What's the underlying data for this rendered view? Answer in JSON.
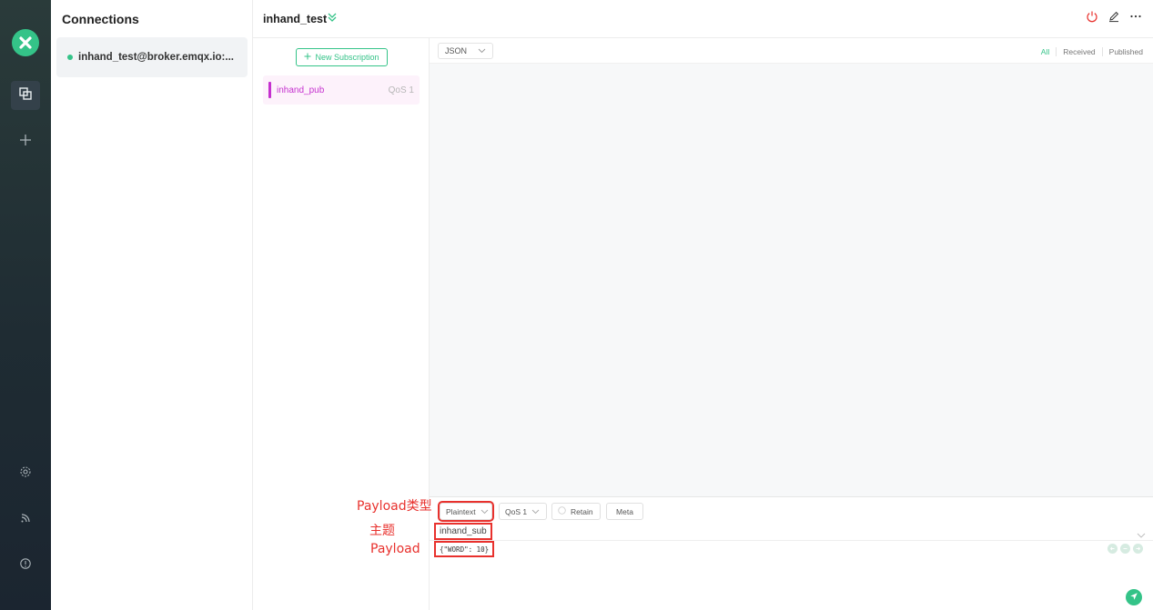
{
  "sidebar": {
    "nav_icons": [
      "connections-icon",
      "plus-icon",
      "settings-icon",
      "feed-icon",
      "info-icon"
    ]
  },
  "connections": {
    "title": "Connections",
    "items": [
      {
        "label": "inhand_test@broker.emqx.io:...",
        "status": "connected"
      }
    ]
  },
  "header": {
    "title": "inhand_test"
  },
  "subscriptions": {
    "new_button": "New Subscription",
    "items": [
      {
        "topic": "inhand_pub",
        "qos": "QoS 1",
        "color": "#c531cf"
      }
    ]
  },
  "messages": {
    "format": "JSON",
    "filters": [
      "All",
      "Received",
      "Published"
    ]
  },
  "publish": {
    "payload_type": "Plaintext",
    "qos": "QoS 1",
    "retain_label": "Retain",
    "meta_label": "Meta",
    "topic": "inhand_sub",
    "payload": "{\"WORD\": 10}"
  },
  "annotations": {
    "payload_type": "Payload类型",
    "topic": "主题",
    "payload": "Payload"
  },
  "colors": {
    "accent": "#34c388",
    "annotation": "#e8312d",
    "disconnect": "#e8312d"
  }
}
